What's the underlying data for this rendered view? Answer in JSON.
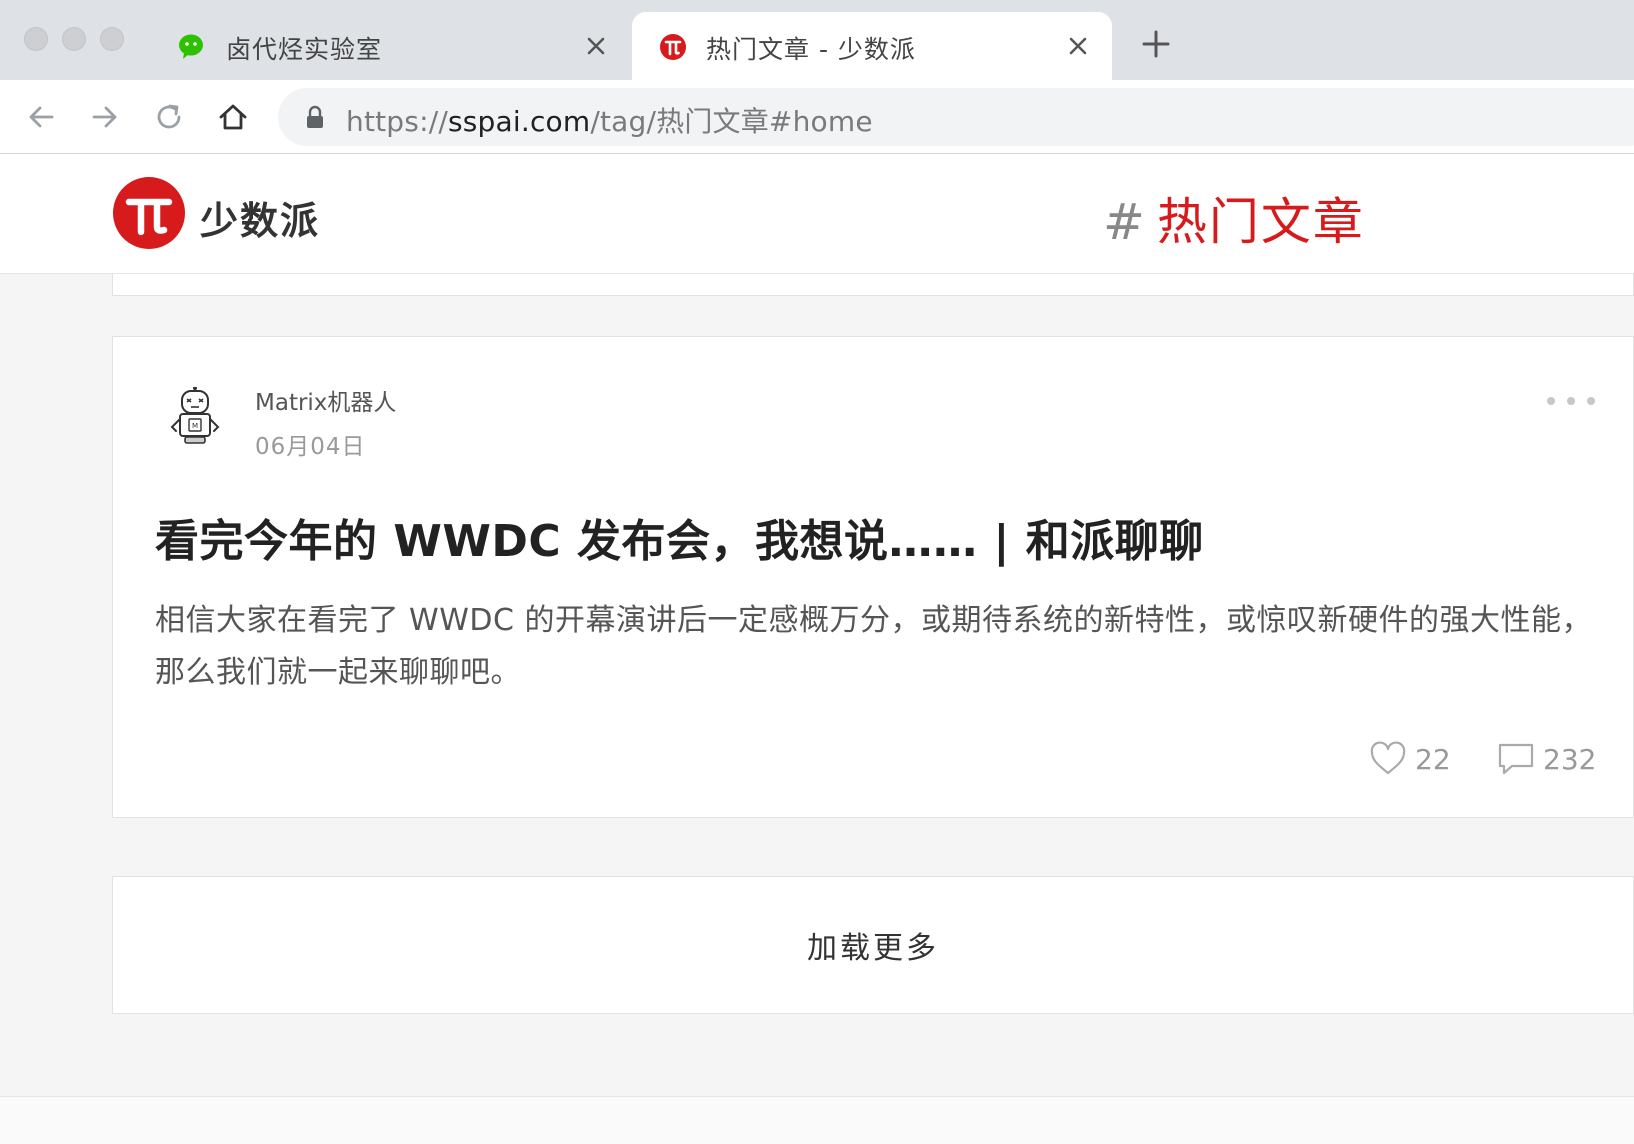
{
  "browser": {
    "tabs": [
      {
        "title": "卤代烃实验室",
        "favicon": "wechat-icon",
        "active": false
      },
      {
        "title": "热门文章 - 少数派",
        "favicon": "sspai-pi-icon",
        "active": true
      }
    ],
    "url": {
      "scheme": "https://",
      "host": "sspai.com",
      "path": "/tag/热门文章#home"
    }
  },
  "site": {
    "logo_text": "少数派",
    "tag_hash": "#",
    "tag_name": "热门文章"
  },
  "article": {
    "author": "Matrix机器人",
    "date": "06月04日",
    "title": "看完今年的 WWDC 发布会，我想说…… | 和派聊聊",
    "summary": "相信大家在看完了 WWDC 的开幕演讲后一定感概万分，或期待系统的新特性，或惊叹新硬件的强大性能，那么我们就一起来聊聊吧。",
    "likes": "22",
    "comments": "232"
  },
  "load_more": "加载更多",
  "colors": {
    "brand_red": "#d71a1b",
    "wechat_green": "#2dc100"
  }
}
